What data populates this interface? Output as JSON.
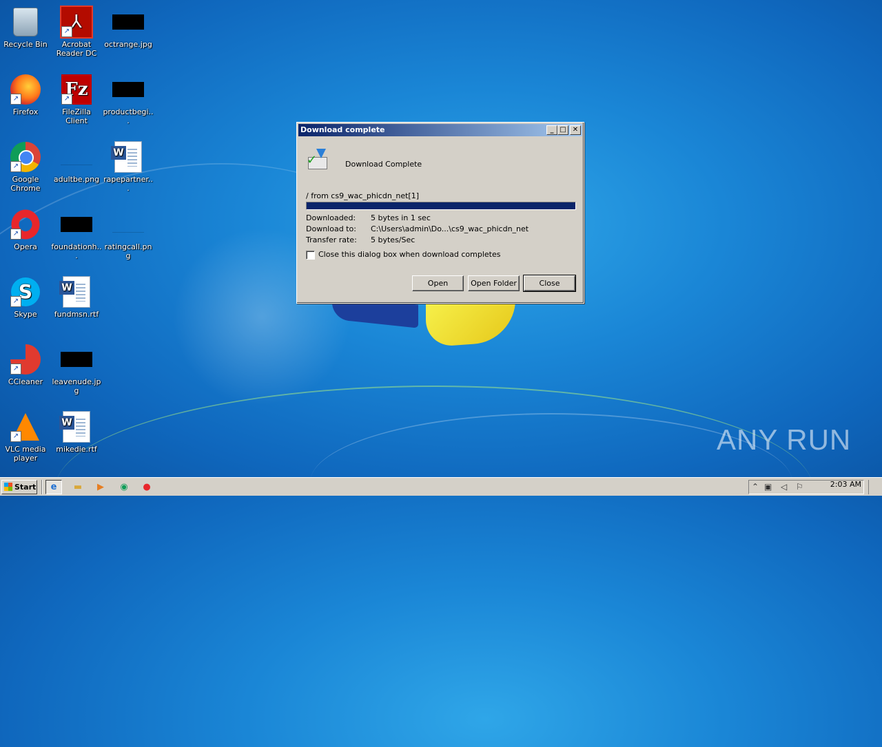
{
  "desktop": {
    "icons": [
      {
        "label": "Recycle Bin"
      },
      {
        "label": "Acrobat Reader DC"
      },
      {
        "label": "octrange.jpg"
      },
      {
        "label": "Firefox"
      },
      {
        "label": "FileZilla Client"
      },
      {
        "label": "productbegi..."
      },
      {
        "label": "Google Chrome"
      },
      {
        "label": "adultbe.png"
      },
      {
        "label": "rapepartner..."
      },
      {
        "label": "Opera"
      },
      {
        "label": "foundationh..."
      },
      {
        "label": "ratingcall.png"
      },
      {
        "label": "Skype"
      },
      {
        "label": "fundmsn.rtf"
      },
      {
        "label": "CCleaner"
      },
      {
        "label": "leavenude.jpg"
      },
      {
        "label": "VLC media player"
      },
      {
        "label": "mikedie.rtf"
      }
    ]
  },
  "dialog": {
    "title": "Download complete",
    "heading": "Download Complete",
    "from_text": "/ from cs9_wac_phicdn_net[1]",
    "progress": 1.0,
    "rows": [
      {
        "label": "Downloaded:",
        "value": "5 bytes in 1 sec"
      },
      {
        "label": "Download to:",
        "value": "C:\\Users\\admin\\Do...\\cs9_wac_phicdn_net"
      },
      {
        "label": "Transfer rate:",
        "value": "5 bytes/Sec"
      }
    ],
    "checkbox_label": "Close this dialog box when download completes",
    "checkbox_checked": false,
    "buttons": {
      "open": "Open",
      "open_folder": "Open Folder",
      "close": "Close"
    }
  },
  "watermark": "ANY RUN",
  "taskbar": {
    "start_label": "Start",
    "clock": "2:03 AM"
  },
  "colors": {
    "titlebar_start": "#0a246a",
    "titlebar_end": "#a6caf0",
    "progress_fill": "#0a246a",
    "desktop_blue": "#1a86d6"
  }
}
